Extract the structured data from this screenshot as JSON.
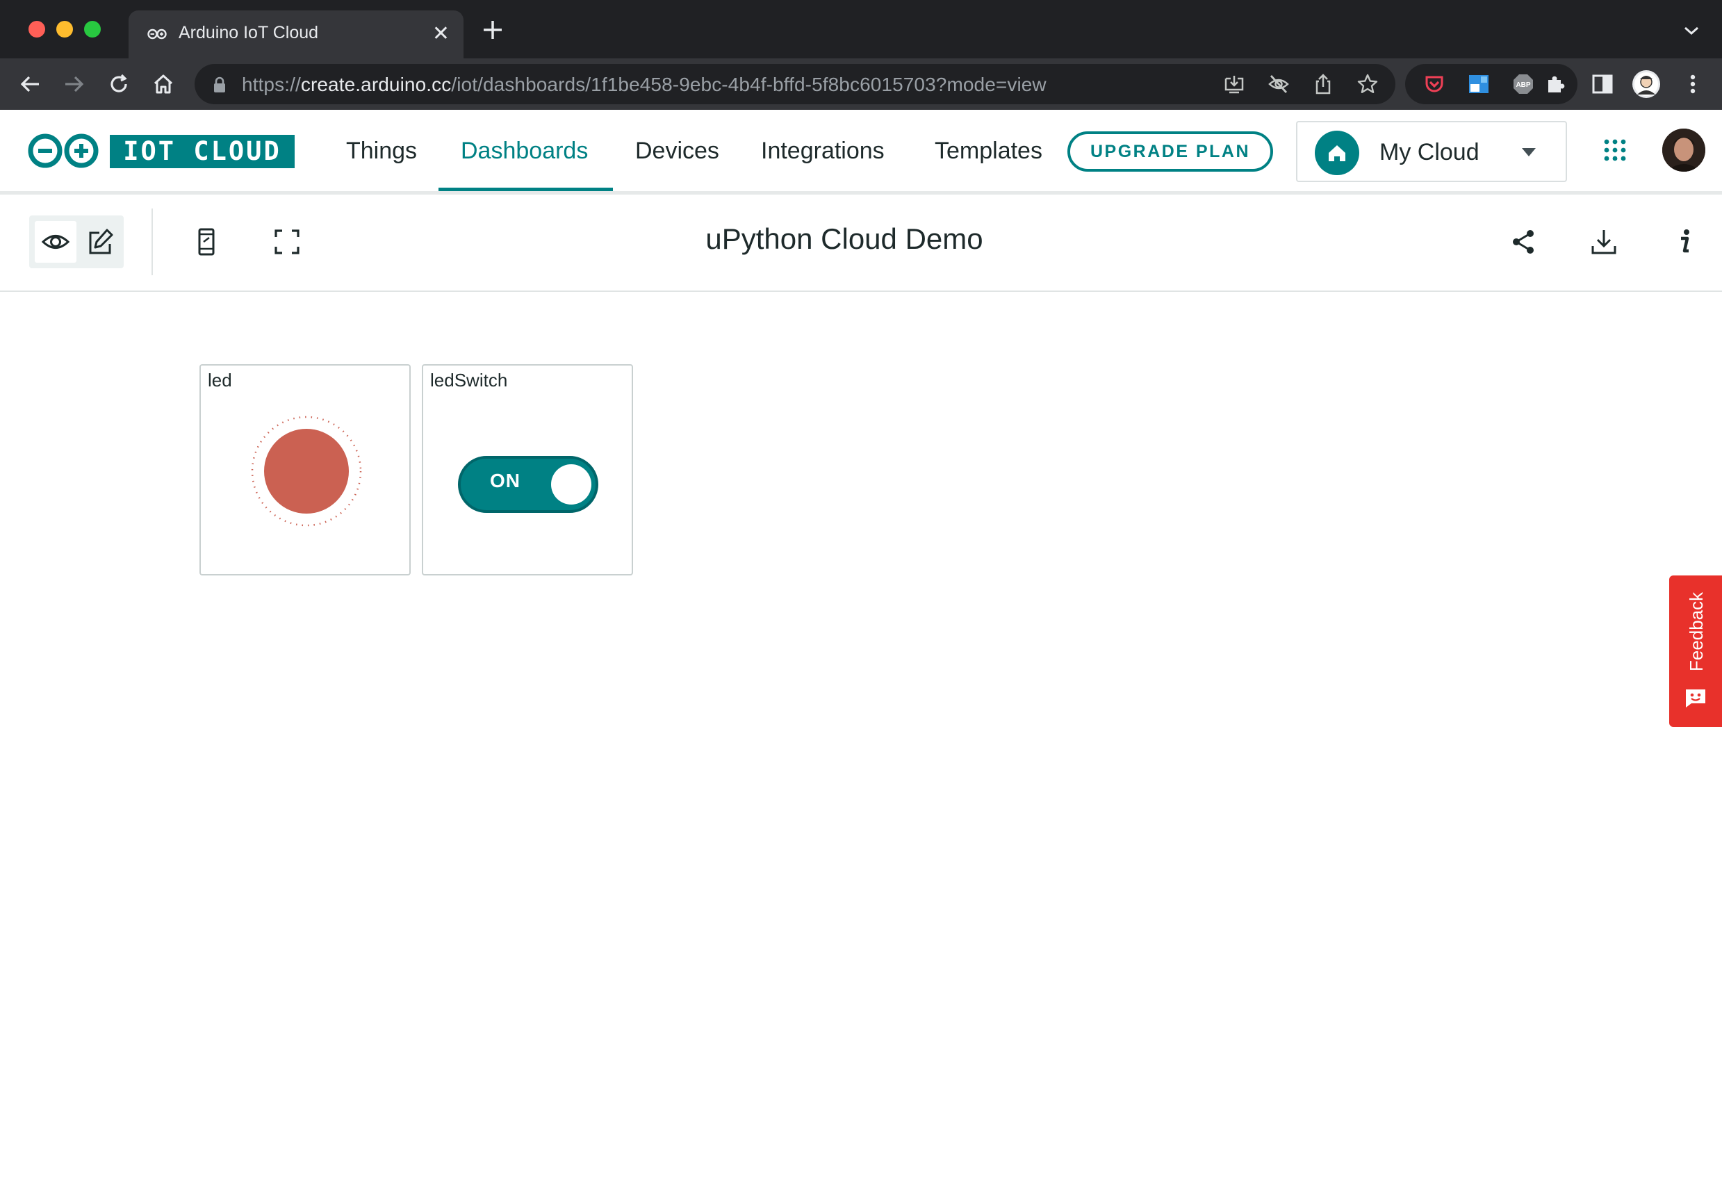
{
  "browser": {
    "tab_title": "Arduino IoT Cloud",
    "tab_close": "✕",
    "url_scheme": "https://",
    "url_host": "create.arduino.cc",
    "url_path": "/iot/dashboards/1f1be458-9ebc-4b4f-bffd-5f8bc6015703?mode=view",
    "extensions": [
      "pocket-icon",
      "tab-manager-icon",
      "adblock-plus-icon",
      "puzzle-extensions-icon"
    ]
  },
  "header": {
    "logo_text": "IOT CLOUD",
    "nav": [
      {
        "label": "Things"
      },
      {
        "label": "Dashboards",
        "active": true
      },
      {
        "label": "Devices"
      },
      {
        "label": "Integrations"
      },
      {
        "label": "Templates"
      }
    ],
    "upgrade_label": "UPGRADE PLAN",
    "space_name": "My Cloud"
  },
  "dashboard": {
    "title": "uPython Cloud Demo",
    "mode": "view"
  },
  "widgets": [
    {
      "title": "led",
      "type": "led",
      "state": true,
      "color": "#cb6152"
    },
    {
      "title": "ledSwitch",
      "type": "switch",
      "state": "ON"
    }
  ],
  "feedback": {
    "label": "Feedback"
  },
  "colors": {
    "accent": "#008184",
    "led_on": "#cb6152",
    "feedback": "#e8312b",
    "chrome_dark": "#202124",
    "chrome_mid": "#35363a"
  }
}
